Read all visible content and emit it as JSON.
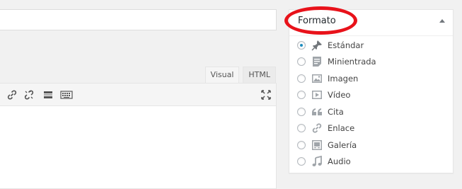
{
  "editor": {
    "tabs": {
      "visual": "Visual",
      "html": "HTML"
    },
    "toolbar_icons": [
      "link-icon",
      "unlink-icon",
      "read-more-icon",
      "keyboard-icon",
      "fullscreen-icon"
    ]
  },
  "format_box": {
    "title": "Formato",
    "toggle_icon": "triangle-up-icon",
    "highlight_color": "#e8121a",
    "selected": "Estándar",
    "options": [
      {
        "label": "Estándar",
        "icon": "pushpin-icon",
        "checked": true
      },
      {
        "label": "Minientrada",
        "icon": "aside-icon",
        "checked": false
      },
      {
        "label": "Imagen",
        "icon": "image-icon",
        "checked": false
      },
      {
        "label": "Vídeo",
        "icon": "video-icon",
        "checked": false
      },
      {
        "label": "Cita",
        "icon": "quote-icon",
        "checked": false
      },
      {
        "label": "Enlace",
        "icon": "link-icon",
        "checked": false
      },
      {
        "label": "Galería",
        "icon": "gallery-icon",
        "checked": false
      },
      {
        "label": "Audio",
        "icon": "audio-icon",
        "checked": false
      }
    ]
  },
  "colors": {
    "accent": "#1e8cbe",
    "icon_gray": "#a0a5aa"
  }
}
